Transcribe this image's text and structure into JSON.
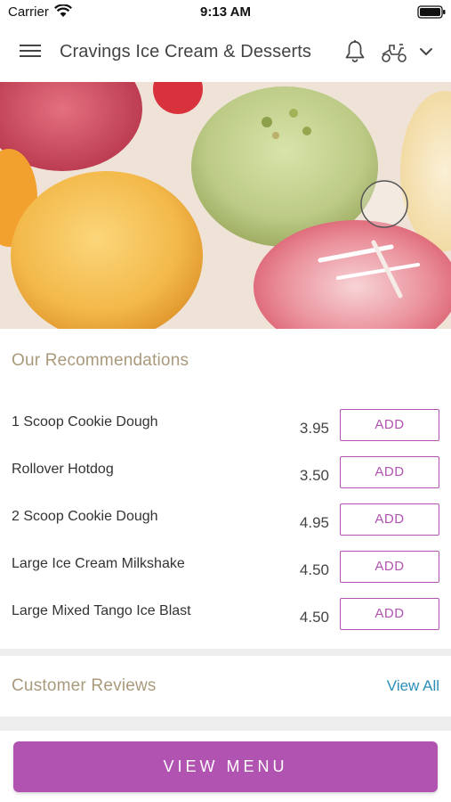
{
  "status_bar": {
    "carrier": "Carrier",
    "time": "9:13 AM",
    "icons": [
      "wifi-icon",
      "battery-icon"
    ]
  },
  "header": {
    "title": "Cravings Ice Cream & Desserts",
    "icons": [
      "menu-icon",
      "bell-icon",
      "scooter-icon",
      "chevron-down-icon"
    ]
  },
  "hero": {
    "image": "ice cream scoops"
  },
  "recommendations": {
    "title": "Our Recommendations",
    "add_label": "ADD",
    "items": [
      {
        "name": "1 Scoop Cookie Dough",
        "price": "3.95",
        "add_label": "ADD"
      },
      {
        "name": "Rollover Hotdog",
        "price": "3.50",
        "add_label": "ADD"
      },
      {
        "name": "2 Scoop Cookie Dough",
        "price": "4.95",
        "add_label": "ADD"
      },
      {
        "name": "Large Ice Cream Milkshake",
        "price": "4.50",
        "add_label": "ADD"
      },
      {
        "name": "Large Mixed Tango Ice Blast",
        "price": "4.50",
        "add_label": "ADD"
      }
    ]
  },
  "reviews": {
    "title": "Customer Reviews",
    "view_all": "View All"
  },
  "footer": {
    "view_menu": "VIEW MENU"
  },
  "colors": {
    "accent": "#b153b0",
    "section_title": "#a99a7c",
    "link": "#2a8fb8"
  }
}
